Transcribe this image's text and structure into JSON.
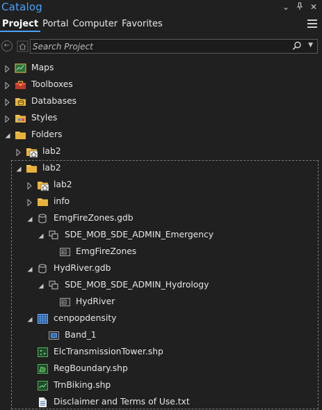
{
  "panel": {
    "title": "Catalog",
    "window_buttons": [
      "⌄",
      "⊓",
      "✕"
    ]
  },
  "tabs": [
    "Project",
    "Portal",
    "Computer",
    "Favorites"
  ],
  "active_tab": "Project",
  "search": {
    "placeholder": "Search Project",
    "value": ""
  },
  "tree": {
    "maps": "Maps",
    "toolboxes": "Toolboxes",
    "databases": "Databases",
    "styles": "Styles",
    "folders": "Folders",
    "folder_lab2_link": "lab2",
    "folder_lab2": "lab2",
    "sub_lab2_link": "lab2",
    "info": "info",
    "emg_gdb": "EmgFireZones.gdb",
    "emg_dataset": "SDE_MOB_SDE_ADMIN_Emergency",
    "emg_fc": "EmgFireZones",
    "hyd_gdb": "HydRiver.gdb",
    "hyd_dataset": "SDE_MOB_SDE_ADMIN_Hydrology",
    "hyd_fc": "HydRiver",
    "raster": "cenpopdensity",
    "band": "Band_1",
    "shp1": "ElcTransmissionTower.shp",
    "shp2": "RegBoundary.shp",
    "shp3": "TrnBiking.shp",
    "txt": "Disclaimer and Terms of Use.txt"
  },
  "colors": {
    "accent": "#4aa3ff",
    "background": "#202020",
    "text": "#e6e6e6",
    "folder": "#f2c14e"
  }
}
